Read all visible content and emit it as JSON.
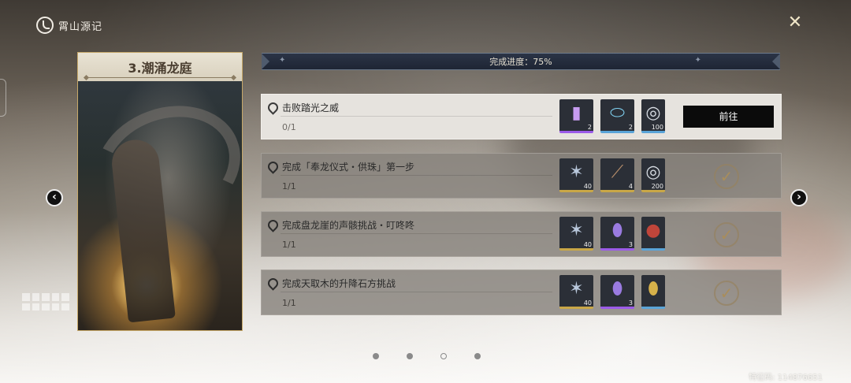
{
  "header": {
    "logo_text": "霄山源记",
    "logo_icon": "dragon-emblem-icon",
    "close_icon": "close-icon"
  },
  "card": {
    "title": "3.潮涌龙庭"
  },
  "progress": {
    "label": "完成进度：75%",
    "value_percent": 75
  },
  "tasks": [
    {
      "title": "击败踏光之威",
      "count": "0/1",
      "status": "active",
      "action": "前往",
      "rewards": [
        {
          "icon": "purple-tube-item-icon",
          "qty": "2",
          "rarity": "purple"
        },
        {
          "icon": "blue-capsule-item-icon",
          "qty": "2",
          "rarity": "blue"
        },
        {
          "icon": "coin-item-icon",
          "qty": "100",
          "rarity": "blue"
        }
      ]
    },
    {
      "title": "完成「奉龙仪式・供珠」第一步",
      "count": "1/1",
      "status": "completed",
      "rewards": [
        {
          "icon": "star-crystal-item-icon",
          "qty": "40",
          "rarity": "gold"
        },
        {
          "icon": "scroll-item-icon",
          "qty": "4",
          "rarity": "gold"
        },
        {
          "icon": "coin-item-icon",
          "qty": "200",
          "rarity": "gold"
        }
      ]
    },
    {
      "title": "完成盘龙崖的声骸挑战・叮咚咚",
      "count": "1/1",
      "status": "completed",
      "rewards": [
        {
          "icon": "star-crystal-item-icon",
          "qty": "40",
          "rarity": "gold"
        },
        {
          "icon": "purple-capsule-item-icon",
          "qty": "3",
          "rarity": "purple"
        },
        {
          "icon": "red-pouch-item-icon",
          "qty": "",
          "rarity": "blue"
        }
      ]
    },
    {
      "title": "完成天取木的升降石方挑战",
      "count": "1/1",
      "status": "completed",
      "rewards": [
        {
          "icon": "star-crystal-item-icon",
          "qty": "40",
          "rarity": "gold"
        },
        {
          "icon": "purple-capsule-item-icon",
          "qty": "3",
          "rarity": "purple"
        },
        {
          "icon": "gold-capsule-item-icon",
          "qty": "",
          "rarity": "blue"
        }
      ]
    }
  ],
  "pagination": {
    "pages": 4,
    "current": 3
  },
  "footer": {
    "uid": "特征码: 114876651"
  },
  "colors": {
    "accent_gold": "#c7a96a",
    "active_row": "#e6e3de",
    "done_row": "#87827c",
    "button_bg": "#0b0b0b"
  }
}
